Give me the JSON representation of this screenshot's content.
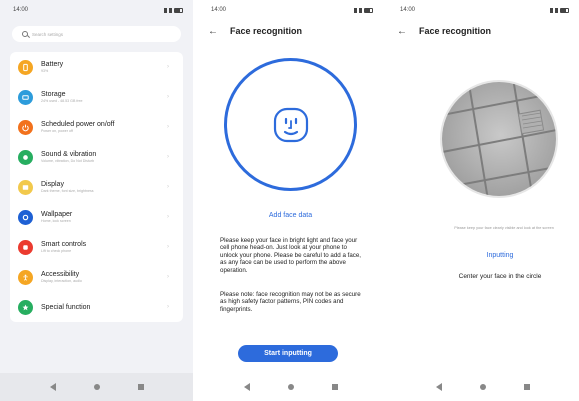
{
  "settings_screen": {
    "status": {
      "time": "14:00"
    },
    "search": {
      "placeholder": "Search settings"
    },
    "items": [
      {
        "title": "Battery",
        "subtitle": "93%",
        "icon": "battery-icon",
        "color": "#f5a623"
      },
      {
        "title": "Storage",
        "subtitle": "24% used - 48.53 GB free",
        "icon": "storage-icon",
        "color": "#2d9cdb"
      },
      {
        "title": "Scheduled power on/off",
        "subtitle": "Power on, power off",
        "icon": "power-icon",
        "color": "#f2711c"
      },
      {
        "title": "Sound & vibration",
        "subtitle": "Volume, vibration, Do Not Disturb",
        "icon": "sound-icon",
        "color": "#27ae60"
      },
      {
        "title": "Display",
        "subtitle": "Dark theme, font size, brightness",
        "icon": "display-icon",
        "color": "#f2c94c"
      },
      {
        "title": "Wallpaper",
        "subtitle": "Home, lock screen",
        "icon": "wallpaper-icon",
        "color": "#1e60d4"
      },
      {
        "title": "Smart controls",
        "subtitle": "Lift to check phone",
        "icon": "smart-controls-icon",
        "color": "#eb3b2f"
      },
      {
        "title": "Accessibility",
        "subtitle": "Display, interaction, audio",
        "icon": "accessibility-icon",
        "color": "#f5a623"
      },
      {
        "title": "Special function",
        "subtitle": "",
        "icon": "special-function-icon",
        "color": "#27ae60"
      }
    ]
  },
  "face_screen": {
    "status": {
      "time": "14:00"
    },
    "title": "Face recognition",
    "add_face": "Add face data",
    "desc_1": "Please keep your face in bright light and face your cell phone head-on. Just look at your phone to unlock your phone. Please be careful to add a face, as any face can be used to perform the above operation.",
    "desc_2": "Please note: face recognition may not be as secure as high safety factor patterns, PIN codes and fingerprints.",
    "start_button": "Start inputting"
  },
  "input_screen": {
    "status": {
      "time": "14:00"
    },
    "title": "Face recognition",
    "hint": "Please keep your face clearly visible and look at the screen",
    "status_text": "Inputting",
    "instruction": "Center your face in the circle"
  }
}
